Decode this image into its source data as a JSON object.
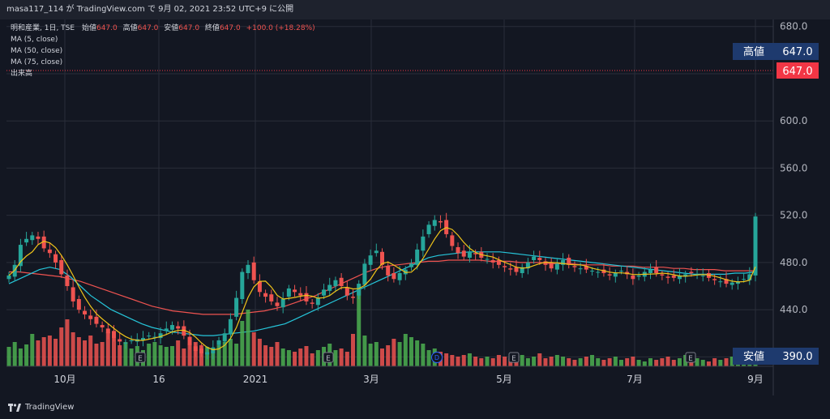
{
  "publish_bar": "masa117_114 が TradingView.com で 9月 02, 2021 23:52 UTC+9 に公開",
  "legend": {
    "symbol": "明和産業, 1日, TSE",
    "open_label": "始値",
    "open_value": "647.0",
    "high_label": "高値",
    "high_value": "647.0",
    "low_label": "安値",
    "low_value": "647.0",
    "close_label": "終値",
    "close_value": "647.0",
    "change": "+100.0 (+18.28%)",
    "ma5": "MA (5, close)",
    "ma50": "MA (50, close)",
    "ma75": "MA (75, close)",
    "volume": "出来高"
  },
  "price_tags": {
    "high_label": "高値",
    "high_value": "647.0",
    "last_value": "647.0",
    "low_label": "安値",
    "low_value": "390.0"
  },
  "event_markers": [
    "E",
    "E",
    "D",
    "E",
    "E"
  ],
  "brand": "TradingView",
  "colors": {
    "background": "#131722",
    "up": "#26a69a",
    "down": "#ef5350",
    "ma5": "#f0c419",
    "ma50": "#26c6da",
    "ma75": "#ef5350",
    "volume_up": "#4caf50",
    "volume_down": "#ef5350",
    "tag_blue": "#1e3a6e",
    "tag_red": "#f23645"
  },
  "chart_data": {
    "type": "candlestick",
    "x_ticks": [
      "10月",
      "16",
      "2021",
      "3月",
      "5月",
      "7月",
      "9月"
    ],
    "y_ticks": [
      "680.0",
      "640.0",
      "600.0",
      "560.0",
      "520.0",
      "480.0",
      "440.0",
      "400.0"
    ],
    "ylim": [
      392,
      686
    ],
    "grid": true,
    "price_series": [
      469,
      478,
      495,
      500,
      503,
      500,
      492,
      488,
      480,
      470,
      460,
      447,
      440,
      436,
      432,
      428,
      425,
      420,
      416,
      413,
      412,
      414,
      415,
      416,
      418,
      417,
      420,
      424,
      427,
      424,
      418,
      410,
      405,
      403,
      404,
      408,
      414,
      420,
      432,
      450,
      472,
      478,
      465,
      455,
      451,
      447,
      443,
      449,
      458,
      455,
      452,
      447,
      445,
      450,
      457,
      461,
      465,
      460,
      452,
      450,
      462,
      479,
      486,
      490,
      478,
      469,
      466,
      471,
      474,
      479,
      491,
      502,
      512,
      516,
      514,
      504,
      494,
      488,
      485,
      489,
      487,
      484,
      483,
      480,
      478,
      476,
      474,
      472,
      476,
      480,
      485,
      482,
      478,
      475,
      479,
      482,
      478,
      476,
      475,
      474,
      473,
      472,
      471,
      469,
      471,
      473,
      470,
      466,
      469,
      472,
      474,
      471,
      469,
      467,
      467,
      469,
      470,
      471,
      470,
      469,
      467,
      465,
      464,
      462,
      463,
      464,
      466,
      470,
      519
    ],
    "ma50_series": [
      462,
      466,
      470,
      474,
      476,
      474,
      468,
      460,
      452,
      446,
      440,
      436,
      432,
      428,
      425,
      423,
      421,
      420,
      419,
      418,
      418,
      419,
      420,
      421,
      422,
      424,
      426,
      428,
      432,
      436,
      440,
      444,
      448,
      452,
      456,
      460,
      464,
      468,
      472,
      476,
      480,
      484,
      486,
      487,
      488,
      489,
      489,
      489,
      489,
      488,
      487,
      486,
      485,
      484,
      483,
      482,
      481,
      480,
      479,
      478,
      477,
      476,
      475,
      474,
      473,
      472,
      471,
      470,
      470,
      470,
      470,
      471,
      471,
      472
    ],
    "ma75_series": [
      472,
      472,
      471,
      470,
      469,
      468,
      466,
      464,
      461,
      458,
      455,
      452,
      449,
      446,
      443,
      441,
      439,
      438,
      437,
      436,
      436,
      436,
      436,
      437,
      438,
      439,
      441,
      443,
      446,
      449,
      452,
      456,
      460,
      464,
      468,
      472,
      475,
      477,
      478,
      479,
      480,
      481,
      481,
      482,
      482,
      482,
      482,
      481,
      481,
      481,
      480,
      480,
      480,
      479,
      479,
      479,
      478,
      478,
      478,
      477,
      477,
      477,
      476,
      476,
      476,
      475,
      475,
      474,
      474,
      474,
      473,
      473,
      473,
      473
    ],
    "volume_series": [
      24,
      30,
      22,
      27,
      40,
      32,
      36,
      38,
      34,
      48,
      58,
      42,
      36,
      32,
      38,
      28,
      30,
      42,
      35,
      26,
      30,
      22,
      25,
      20,
      28,
      30,
      26,
      24,
      25,
      32,
      22,
      28,
      30,
      26,
      24,
      20,
      26,
      30,
      34,
      28,
      56,
      70,
      42,
      34,
      26,
      24,
      30,
      22,
      20,
      18,
      22,
      25,
      16,
      20,
      24,
      28,
      20,
      22,
      18,
      40,
      95,
      38,
      28,
      30,
      22,
      26,
      34,
      30,
      40,
      36,
      32,
      28,
      20,
      22,
      18,
      16,
      14,
      12,
      14,
      16,
      12,
      10,
      12,
      10,
      14,
      12,
      10,
      12,
      14,
      10,
      12,
      16,
      10,
      12,
      14,
      12,
      10,
      8,
      10,
      12,
      14,
      10,
      8,
      10,
      12,
      8,
      10,
      12,
      8,
      6,
      10,
      8,
      10,
      12,
      8,
      10,
      14,
      12,
      10,
      8,
      6,
      10,
      8,
      10,
      12,
      14,
      16,
      10,
      22
    ],
    "unit": "JPY"
  }
}
